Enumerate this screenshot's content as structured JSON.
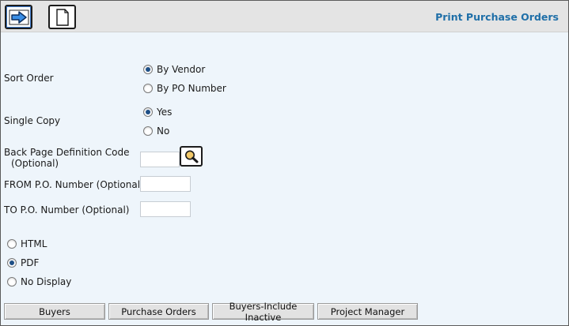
{
  "header": {
    "title": "Print Purchase Orders",
    "icons": [
      "arrow-right-icon",
      "document-icon"
    ]
  },
  "form": {
    "sort_order": {
      "label": "Sort Order",
      "options": [
        {
          "label": "By Vendor",
          "checked": true
        },
        {
          "label": "By PO Number",
          "checked": false
        }
      ]
    },
    "single_copy": {
      "label": "Single Copy",
      "options": [
        {
          "label": "Yes",
          "checked": true
        },
        {
          "label": "No",
          "checked": false
        }
      ]
    },
    "back_page": {
      "label_line1": "Back Page Definition Code",
      "label_line2": "(Optional)",
      "value": ""
    },
    "from_po": {
      "label": "FROM P.O. Number (Optional)",
      "value": ""
    },
    "to_po": {
      "label": "TO P.O. Number (Optional)",
      "value": ""
    },
    "output_format": {
      "options": [
        {
          "label": "HTML",
          "checked": false
        },
        {
          "label": "PDF",
          "checked": true
        },
        {
          "label": "No Display",
          "checked": false
        }
      ]
    }
  },
  "buttons": [
    "Buyers",
    "Purchase Orders",
    "Buyers-Include Inactive",
    "Project Manager"
  ],
  "colors": {
    "title": "#1f6fa8",
    "background": "#eef5fb",
    "toolbar": "#e4e4e4",
    "radio_dot": "#1e4f86"
  }
}
